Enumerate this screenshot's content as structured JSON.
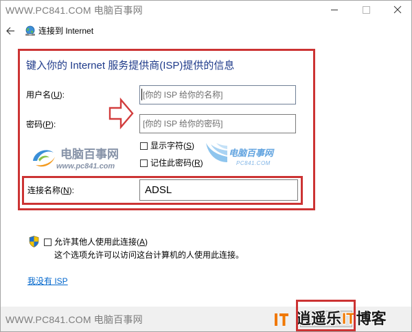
{
  "window": {
    "watermark_top": "WWW.PC841.COM 电脑百事网",
    "icons": {
      "minimize": "minimize-icon",
      "maximize": "maximize-icon",
      "close": "close-icon"
    }
  },
  "nav": {
    "back_icon": "back-arrow-icon",
    "title_icon": "network-globe-icon",
    "title": "连接到 Internet"
  },
  "form": {
    "heading": "键入你的 Internet 服务提供商(ISP)提供的信息",
    "username": {
      "label_pre": "用户名(",
      "accel": "U",
      "label_post": "):",
      "placeholder": "[你的 ISP 给你的名称]"
    },
    "password": {
      "label_pre": "密码(",
      "accel": "P",
      "label_post": "):",
      "placeholder": "[你的 ISP 给你的密码]"
    },
    "show_chars": {
      "label_pre": "显示字符(",
      "accel": "S",
      "label_post": ")",
      "checked": false
    },
    "remember": {
      "label_pre": "记住此密码(",
      "accel": "R",
      "label_post": ")",
      "checked": false
    },
    "connection_name": {
      "label_pre": "连接名称(",
      "accel": "N",
      "label_post": "):",
      "value": "ADSL"
    }
  },
  "sharing": {
    "icon": "uac-shield-icon",
    "allow": {
      "label_pre": "允许其他人使用此连接(",
      "accel": "A",
      "label_post": ")",
      "checked": false
    },
    "description": "这个选项允许可以访问这台计算机的人使用此连接。"
  },
  "no_isp_link": "我没有 ISP",
  "watermarks": {
    "left": {
      "name": "电脑百事网",
      "url": "www.pc841.com"
    },
    "right": {
      "name": "电脑百事网",
      "url": "PC841.COM"
    }
  },
  "footer": {
    "watermark": "WWW.PC841.COM 电脑百事网",
    "logo": {
      "part1": "逍遥乐",
      "part2": "IT",
      "part3": "博客"
    }
  },
  "colors": {
    "heading": "#1e3a8a",
    "link": "#0066cc",
    "highlight_red": "#cc3333",
    "logo_orange": "#f07800",
    "footer_bg": "#f0f0f0"
  }
}
